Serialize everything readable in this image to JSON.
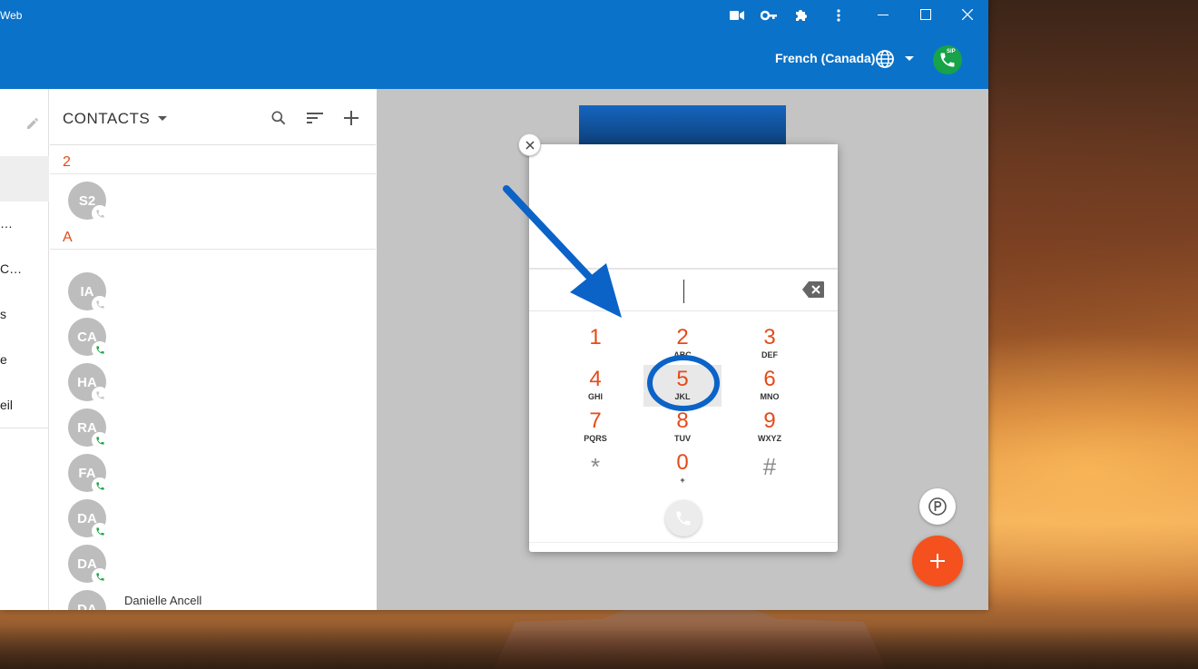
{
  "window": {
    "title": "Web"
  },
  "appbar": {
    "language": "French (Canada)",
    "sip_badge": "SIP"
  },
  "leftnav": {
    "items": [
      "…",
      "C…",
      "s",
      "e",
      "eil"
    ]
  },
  "contacts": {
    "title": "CONTACTS",
    "sections": [
      {
        "letter": "2",
        "avatars": [
          "S2"
        ]
      },
      {
        "letter": "A",
        "avatars": [
          "IA",
          "CA",
          "HA",
          "RA",
          "FA",
          "DA",
          "DA",
          "DA"
        ]
      }
    ],
    "partial_name": "Danielle Ancell"
  },
  "dialer": {
    "keys": [
      {
        "digit": "1",
        "letters": ""
      },
      {
        "digit": "2",
        "letters": "ABC"
      },
      {
        "digit": "3",
        "letters": "DEF"
      },
      {
        "digit": "4",
        "letters": "GHI"
      },
      {
        "digit": "5",
        "letters": "JKL"
      },
      {
        "digit": "6",
        "letters": "MNO"
      },
      {
        "digit": "7",
        "letters": "PQRS"
      },
      {
        "digit": "8",
        "letters": "TUV"
      },
      {
        "digit": "9",
        "letters": "WXYZ"
      },
      {
        "digit": "*",
        "letters": ""
      },
      {
        "digit": "0",
        "letters": "+"
      },
      {
        "digit": "#",
        "letters": ""
      }
    ]
  },
  "colors": {
    "primary": "#0b72c9",
    "accent": "#e64a19",
    "fab": "#f4511e",
    "annotation": "#0b63c7",
    "sip_green": "#16a34a"
  },
  "icons": [
    "video-icon",
    "key-icon",
    "puzzle-icon",
    "more-vert-icon",
    "minimize-icon",
    "maximize-icon",
    "close-icon",
    "globe-icon",
    "phone-icon",
    "search-icon",
    "sort-icon",
    "add-icon",
    "edit-icon",
    "backspace-icon",
    "parking-icon"
  ]
}
